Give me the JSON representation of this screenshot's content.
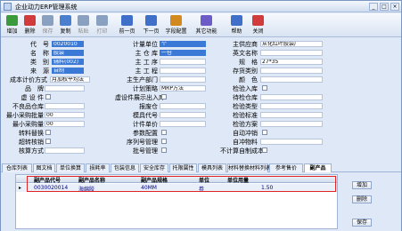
{
  "window": {
    "title": "企业动力ERP管理系统"
  },
  "toolbar": {
    "buttons": [
      {
        "label": "增加",
        "icon": "add-icon",
        "enabled": true
      },
      {
        "label": "删除",
        "icon": "delete-icon",
        "enabled": true
      },
      {
        "label": "保存",
        "icon": "save-icon",
        "enabled": false
      },
      {
        "label": "复制",
        "icon": "copy-icon",
        "enabled": true
      },
      {
        "label": "粘贴",
        "icon": "paste-icon",
        "enabled": false
      },
      {
        "label": "打印",
        "icon": "print-icon",
        "enabled": false
      },
      {
        "label": "前一页",
        "icon": "previous-page-icon",
        "enabled": true
      },
      {
        "label": "下一页",
        "icon": "next-page-icon",
        "enabled": true
      },
      {
        "label": "字段配置",
        "icon": "field-config-icon",
        "enabled": true
      },
      {
        "label": "其它功能",
        "icon": "other-functions-icon",
        "enabled": true
      },
      {
        "label": "帮助",
        "icon": "help-icon",
        "enabled": true
      },
      {
        "label": "关闭",
        "icon": "close-icon",
        "enabled": true
      }
    ]
  },
  "form": {
    "col1": [
      {
        "label": "代　号",
        "value": "0020010",
        "selected": true
      },
      {
        "label": "名　称",
        "value": "胶袋",
        "selected": true
      },
      {
        "label": "类　别",
        "value": "辅料(002)",
        "selected": true
      },
      {
        "label": "来　源",
        "value": "自制",
        "selected": true
      }
    ],
    "cost_method": {
      "label": "成本计价方式",
      "value": "月加权平均法"
    },
    "col1_lower": [
      {
        "label": "品　牌"
      },
      {
        "label": "虚 设 件"
      },
      {
        "label": "不良品仓库"
      },
      {
        "label": "最小采购批量",
        "value": "00"
      },
      {
        "label": "最小采购量",
        "value": "00"
      },
      {
        "label": "转料替换"
      },
      {
        "label": "超转核销"
      },
      {
        "label": "核算方式"
      }
    ],
    "col2": [
      {
        "label": "计量单位",
        "value": "个",
        "selected": true
      },
      {
        "label": "主 仓 库",
        "value": "一仓",
        "selected": true
      },
      {
        "label": "主 工 序"
      },
      {
        "label": "主 工 程"
      },
      {
        "label": "主生产部门"
      },
      {
        "label": "计划策略",
        "value": "MRP方法"
      },
      {
        "label": "虚设件展示出入库"
      },
      {
        "label": "报废仓"
      },
      {
        "label": "模具代号"
      },
      {
        "label": "计件单价"
      },
      {
        "label": "参数配置"
      },
      {
        "label": "序列号管理"
      },
      {
        "label": "批号管理"
      }
    ],
    "col3": [
      {
        "label": "主供应商",
        "value": "从化红叶胶袋厂"
      },
      {
        "label": "英文名称"
      },
      {
        "label": "规　格",
        "value": "27*35"
      },
      {
        "label": "存货类别"
      },
      {
        "label": "颜　色"
      },
      {
        "label": "检验入库"
      },
      {
        "label": "待检仓库"
      },
      {
        "label": "检验类型"
      },
      {
        "label": "检验标准"
      },
      {
        "label": "检验方案"
      },
      {
        "label": "自动冲销"
      },
      {
        "label": "自冲物料"
      },
      {
        "label": "不计算自制成本"
      }
    ]
  },
  "tabs": [
    "仓库列表",
    "图文档",
    "单位换算",
    "损耗率",
    "包装信息",
    "安全库存",
    "托限属性",
    "模具列表",
    "材料替换材料列表",
    "参考售价",
    "副产品"
  ],
  "active_tab": "副产品",
  "grid": {
    "columns": [
      "副产品代号",
      "副产品名称",
      "副产品规格",
      "单位",
      "单位用量"
    ],
    "rows": [
      [
        "0030020014",
        "海绵胶",
        "40MM",
        "卷",
        "1.50"
      ]
    ]
  },
  "panel_buttons": {
    "add": "增加",
    "delete": "删除",
    "save": "保存"
  },
  "colors": {
    "selected_field": "#3a7ad6",
    "highlight_box": "#e02424",
    "window_bg": "#dfe8f6"
  }
}
